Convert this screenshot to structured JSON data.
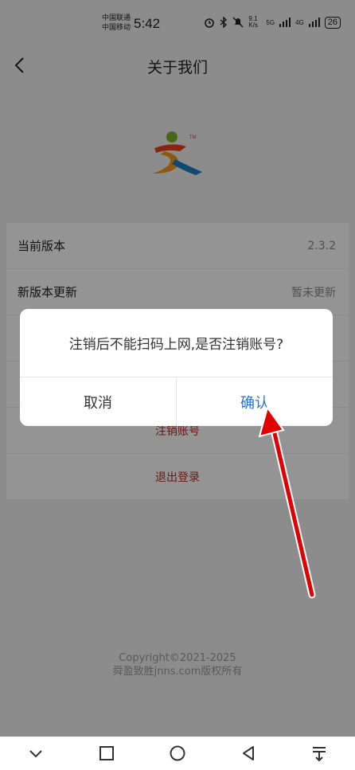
{
  "status": {
    "carrier1": "中国联通",
    "carrier2": "中国移动",
    "time": "5:42",
    "net_speed": "9.1 K/s",
    "net1": "5G",
    "net2": "4G",
    "battery": "26"
  },
  "header": {
    "title": "关于我们"
  },
  "info": {
    "rows": [
      {
        "label": "当前版本",
        "value": "2.3.2"
      },
      {
        "label": "新版本更新",
        "value": "暂未更新"
      },
      {
        "label": "",
        "value": ""
      },
      {
        "label": "",
        "value": ""
      }
    ]
  },
  "actions": {
    "cancel_account": "注销账号",
    "logout": "退出登录"
  },
  "footer": {
    "copyright_line1": "Copyright©2021-2025",
    "copyright_line2": "舜盈致胜jnns.com版权所有"
  },
  "dialog": {
    "message": "注销后不能扫码上网,是否注销账号?",
    "cancel": "取消",
    "confirm": "确认"
  },
  "colors": {
    "accent": "#2a6fd6",
    "danger": "#b52a2a",
    "annotation": "#e00000"
  }
}
